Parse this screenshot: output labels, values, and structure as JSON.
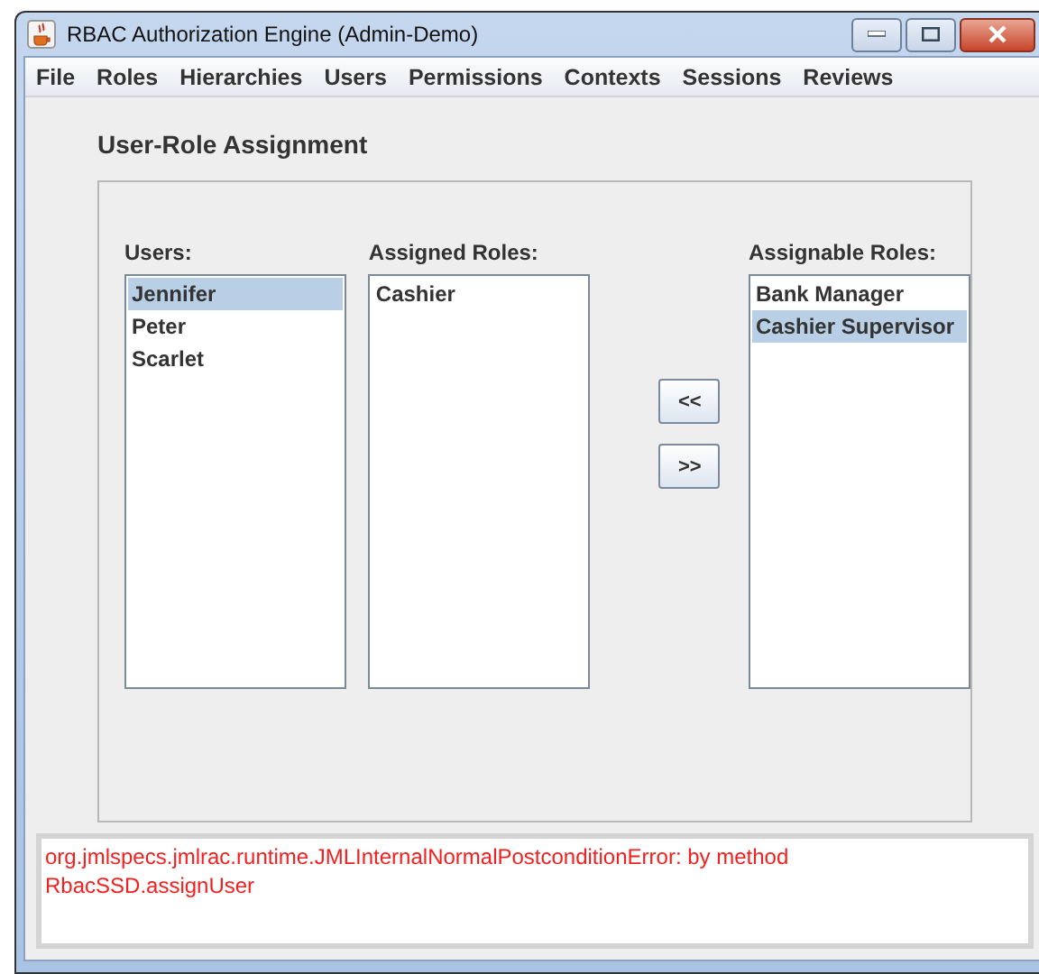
{
  "window": {
    "title": "RBAC Authorization Engine (Admin-Demo)"
  },
  "menu": [
    "File",
    "Roles",
    "Hierarchies",
    "Users",
    "Permissions",
    "Contexts",
    "Sessions",
    "Reviews"
  ],
  "heading": "User-Role Assignment",
  "users": {
    "label": "Users:",
    "items": [
      {
        "text": "Jennifer",
        "selected": true
      },
      {
        "text": "Peter",
        "selected": false
      },
      {
        "text": "Scarlet",
        "selected": false
      }
    ]
  },
  "assigned_roles": {
    "label": "Assigned Roles:",
    "items": [
      {
        "text": "Cashier",
        "selected": false
      }
    ]
  },
  "buttons": [
    "<<",
    ">>"
  ],
  "assignable_roles": {
    "label": "Assignable Roles:",
    "items": [
      {
        "text": "Bank Manager",
        "selected": false
      },
      {
        "text": "Cashier Supervisor",
        "selected": true
      }
    ]
  },
  "message": "org.jmlspecs.jmlrac.runtime.JMLInternalNormalPostconditionError: by method RbacSSD.assignUser"
}
